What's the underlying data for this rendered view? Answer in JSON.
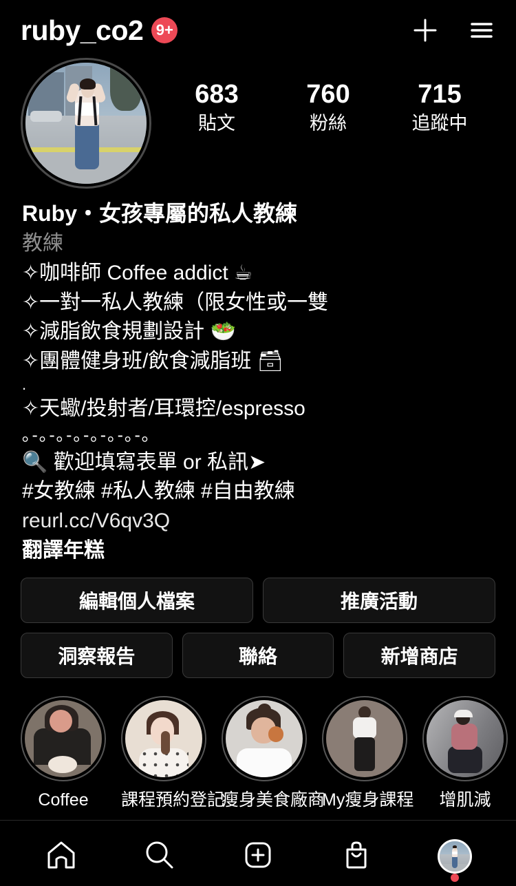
{
  "header": {
    "username": "ruby_co2",
    "notification_badge": "9+",
    "add_icon": "plus-icon",
    "menu_icon": "hamburger-menu-icon"
  },
  "profile": {
    "avatar_alt": "profile-photo",
    "stats": [
      {
        "value": "683",
        "label": "貼文"
      },
      {
        "value": "760",
        "label": "粉絲"
      },
      {
        "value": "715",
        "label": "追蹤中"
      }
    ],
    "display_name": "Ruby・女孩專屬的私人教練",
    "category": "教練",
    "bio_lines": [
      "✧咖啡師 Coffee addict ☕",
      "✧一對一私人教練（限女性或一雙",
      "✧減脂飲食規劃設計 🥗",
      "✧團體健身班/飲食減脂班 🗃",
      ".",
      "✧天蠍/投射者/耳環控/espresso",
      "｡-｡-｡-｡-｡-｡-｡-｡",
      "🔍 歡迎填寫表單 or 私訊➤",
      "#女教練 #私人教練 #自由教練"
    ],
    "link": "reurl.cc/V6qv3Q",
    "translate_label": "翻譯年糕"
  },
  "actions": {
    "row1": [
      "編輯個人檔案",
      "推廣活動"
    ],
    "row2": [
      "洞察報告",
      "聯絡",
      "新增商店"
    ]
  },
  "highlights": [
    {
      "label": "Coffee"
    },
    {
      "label": "課程預約登記"
    },
    {
      "label": "瘦身美食廠商"
    },
    {
      "label": "My瘦身課程"
    },
    {
      "label": "增肌減"
    }
  ],
  "bottom_nav": [
    {
      "icon": "home-icon"
    },
    {
      "icon": "search-icon"
    },
    {
      "icon": "create-post-icon"
    },
    {
      "icon": "shop-bag-icon"
    },
    {
      "icon": "profile-avatar-icon"
    }
  ],
  "colors": {
    "background": "#000000",
    "badge_red": "#ED4956",
    "muted_text": "#8e8e8e"
  }
}
